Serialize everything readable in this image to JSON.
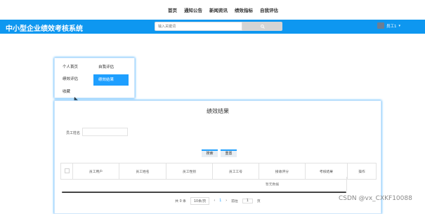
{
  "top_nav": [
    "首页",
    "通知公告",
    "新闻资讯",
    "绩效指标",
    "自我评估"
  ],
  "header": {
    "title": "中小型企业绩效考核系统",
    "search_placeholder": "输入关键词",
    "user_name": "员工1",
    "accent": "#0e97f0"
  },
  "menu": [
    {
      "label": "个人首页"
    },
    {
      "label": "自我评估"
    },
    {
      "label": "绩效评估"
    },
    {
      "label": "绩效结果",
      "active": true
    },
    {
      "label": "收藏"
    }
  ],
  "panel": {
    "title": "绩效结果",
    "field_label": "员工姓名",
    "search_button": "搜索",
    "reset_button": "重置",
    "columns": [
      "员工用户",
      "员工姓名",
      "员工性别",
      "员工工号",
      "接收评分",
      "考核结果",
      "操作"
    ],
    "empty_text": "暂无数据",
    "pager": {
      "total": "共 0 条",
      "page_size": "10条/页",
      "prev": "‹",
      "current_page": "1",
      "next": "›",
      "goto_label": "前往",
      "goto_value": "1",
      "page_suffix": "页"
    }
  },
  "watermark": "CSDN @vx_CXKF10088"
}
